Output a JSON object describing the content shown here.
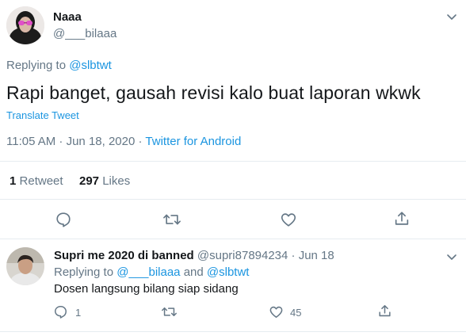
{
  "main_tweet": {
    "author_name": "Naaa",
    "author_handle": "@___bilaaa",
    "replying_prefix": "Replying to",
    "replying_to": "@slbtwt",
    "text": "Rapi banget, gausah revisi kalo buat laporan wkwk",
    "translate_label": "Translate Tweet",
    "timestamp": "11:05 AM · Jun 18, 2020 · ",
    "source": "Twitter for Android",
    "retweet_count": "1",
    "retweet_label": "Retweet",
    "like_count": "297",
    "like_label": "Likes",
    "actions": [
      "reply-icon",
      "retweet-icon",
      "like-icon",
      "share-icon"
    ]
  },
  "reply_tweet": {
    "author_name": "Supri me 2020 di banned",
    "author_handle": "@supri87894234",
    "date": "· Jun 18",
    "replying_prefix": "Replying to",
    "replying_to_1": "@___bilaaa",
    "replying_and": "and",
    "replying_to_2": "@slbtwt",
    "text": "Dosen langsung bilang siap sidang",
    "reply_count": "1",
    "like_count": "45"
  },
  "colors": {
    "accent": "#1b95e0",
    "muted": "#657786",
    "text": "#14171a",
    "divider": "#e6ecf0"
  }
}
